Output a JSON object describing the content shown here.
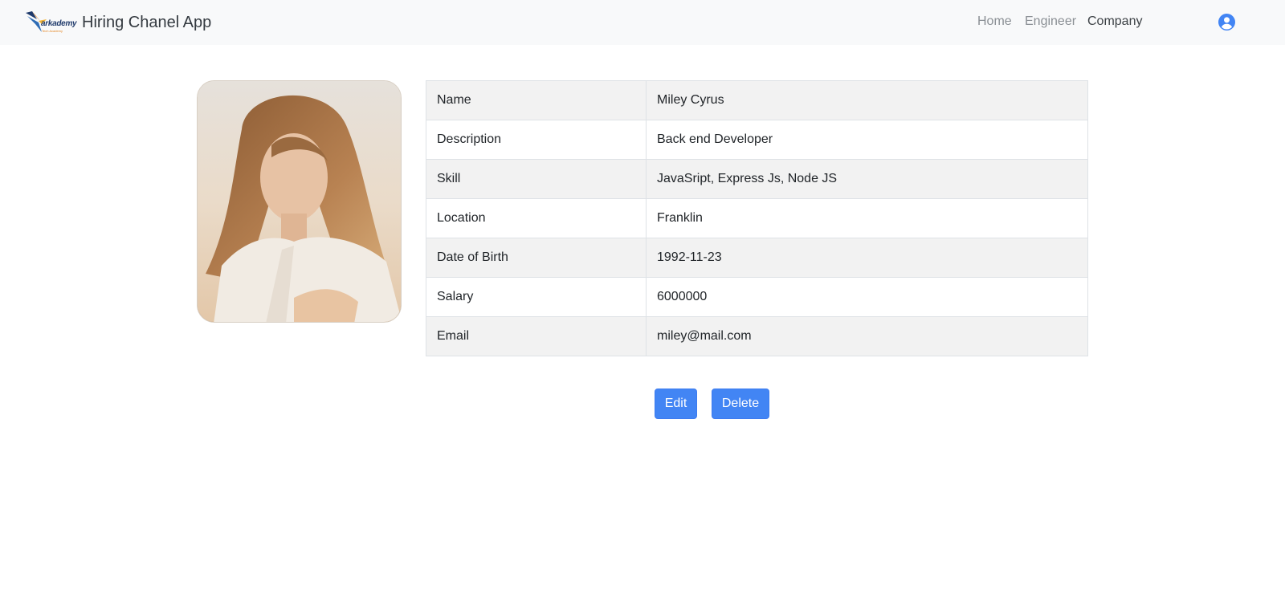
{
  "navbar": {
    "logo_word": "arkademy",
    "logo_sub": "Tech Academy",
    "brand": "Hiring Chanel App",
    "links": [
      {
        "label": "Home"
      },
      {
        "label": "Engineer"
      },
      {
        "label": "Company"
      }
    ],
    "user_icon": "user-circle-icon"
  },
  "profile": {
    "photo": "profile-photo",
    "rows": [
      {
        "key": "Name",
        "value": "Miley Cyrus"
      },
      {
        "key": "Description",
        "value": "Back end Developer"
      },
      {
        "key": "Skill",
        "value": "JavaSript, Express Js, Node JS"
      },
      {
        "key": "Location",
        "value": "Franklin"
      },
      {
        "key": "Date of Birth",
        "value": "1992-11-23"
      },
      {
        "key": "Salary",
        "value": "6000000"
      },
      {
        "key": "Email",
        "value": "miley@mail.com"
      }
    ]
  },
  "actions": {
    "edit_label": "Edit",
    "delete_label": "Delete"
  },
  "colors": {
    "navbar_bg": "#f8f9fa",
    "primary": "#4285f4",
    "striped_row": "#f2f2f2"
  }
}
